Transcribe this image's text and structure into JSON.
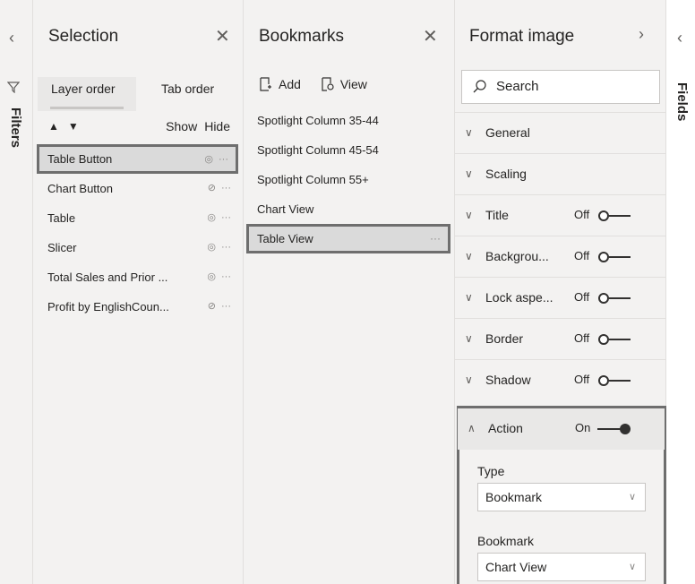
{
  "filters": {
    "collapse_icon": "chevron-left-icon",
    "label": "Filters"
  },
  "selection": {
    "title": "Selection",
    "tabs": [
      "Layer order",
      "Tab order"
    ],
    "show_label": "Show",
    "hide_label": "Hide",
    "layers": [
      {
        "name": "Table Button",
        "visible": true,
        "selected": true
      },
      {
        "name": "Chart Button",
        "visible": false,
        "selected": false
      },
      {
        "name": "Table",
        "visible": true,
        "selected": false
      },
      {
        "name": "Slicer",
        "visible": true,
        "selected": false
      },
      {
        "name": "Total Sales and Prior ...",
        "visible": true,
        "selected": false
      },
      {
        "name": "Profit by EnglishCoun...",
        "visible": false,
        "selected": false
      }
    ]
  },
  "bookmarks": {
    "title": "Bookmarks",
    "add_label": "Add",
    "view_label": "View",
    "items": [
      {
        "name": "Spotlight Column 35-44",
        "selected": false
      },
      {
        "name": "Spotlight Column 45-54",
        "selected": false
      },
      {
        "name": "Spotlight Column 55+",
        "selected": false
      },
      {
        "name": "Chart View",
        "selected": false
      },
      {
        "name": "Table View",
        "selected": true
      }
    ]
  },
  "format": {
    "title": "Format image",
    "search_placeholder": "Search",
    "sections": [
      {
        "label": "General",
        "state": ""
      },
      {
        "label": "Scaling",
        "state": ""
      },
      {
        "label": "Title",
        "state": "Off"
      },
      {
        "label": "Backgrou...",
        "state": "Off"
      },
      {
        "label": "Lock aspe...",
        "state": "Off"
      },
      {
        "label": "Border",
        "state": "Off"
      },
      {
        "label": "Shadow",
        "state": "Off"
      }
    ],
    "action": {
      "label": "Action",
      "state": "On",
      "type_label": "Type",
      "type_value": "Bookmark",
      "bookmark_label": "Bookmark",
      "bookmark_value": "Chart View"
    }
  },
  "fields": {
    "label": "Fields"
  },
  "colors": {
    "pane_bg": "#f3f2f1",
    "highlight_border": "#6e6e6e",
    "selected_bg": "#dadada"
  }
}
